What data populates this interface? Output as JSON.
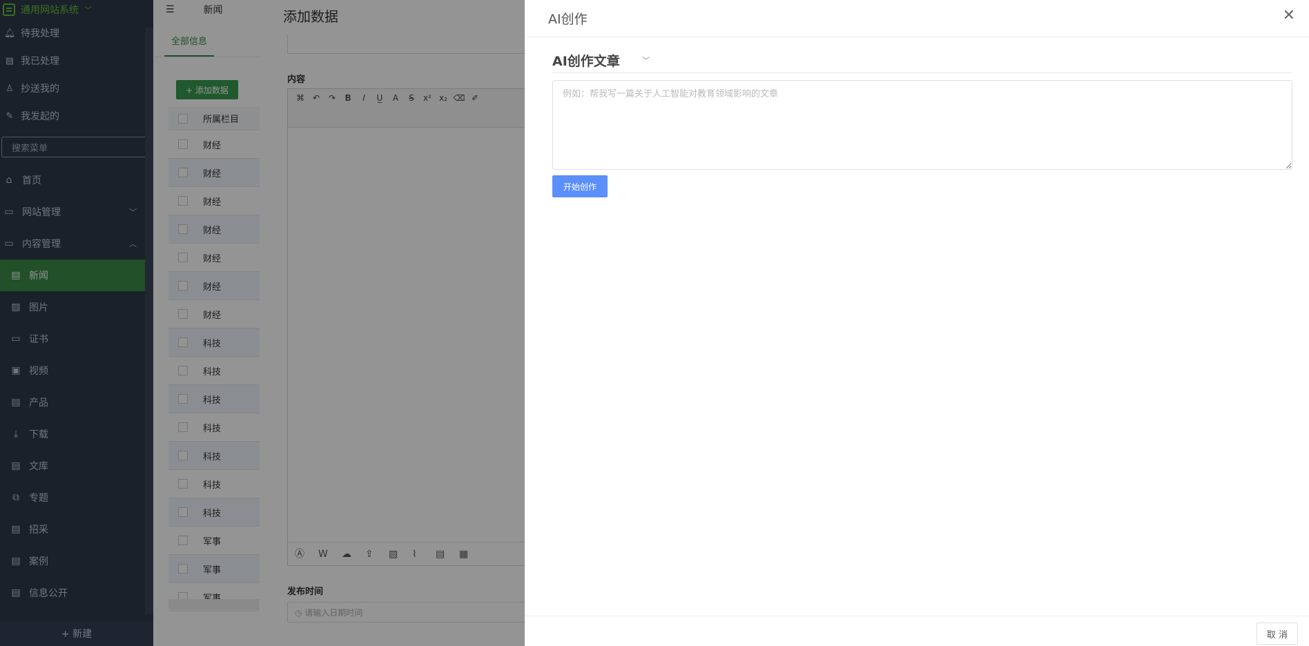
{
  "sidebar": {
    "logo": "通用网站系统",
    "quick": [
      {
        "label": "待我处理",
        "icon": "bell-icon"
      },
      {
        "label": "我已处理",
        "icon": "document-icon"
      },
      {
        "label": "抄送我的",
        "icon": "user-icon"
      },
      {
        "label": "我发起的",
        "icon": "edit-icon"
      }
    ],
    "search_placeholder": "搜索菜单",
    "menu": [
      {
        "label": "首页",
        "icon": "home-icon"
      },
      {
        "label": "网站管理",
        "icon": "folder-icon"
      },
      {
        "label": "内容管理",
        "icon": "folder-icon"
      },
      {
        "label": "新闻",
        "icon": "news-icon"
      },
      {
        "label": "图片",
        "icon": "image-icon"
      },
      {
        "label": "证书",
        "icon": "certificate-icon"
      },
      {
        "label": "视频",
        "icon": "video-icon"
      },
      {
        "label": "产品",
        "icon": "product-icon"
      },
      {
        "label": "下载",
        "icon": "download-icon"
      },
      {
        "label": "文库",
        "icon": "library-icon"
      },
      {
        "label": "专题",
        "icon": "topic-icon"
      },
      {
        "label": "招采",
        "icon": "procurement-icon"
      },
      {
        "label": "案例",
        "icon": "case-icon"
      },
      {
        "label": "信息公开",
        "icon": "info-icon"
      }
    ],
    "new_button": "+ 新建"
  },
  "main": {
    "top_tab": "新闻",
    "sub_tabs": [
      "全部信息"
    ],
    "add_button": "+ 添加数据",
    "grid": {
      "header": "所属栏目",
      "rows": [
        "财经",
        "财经",
        "财经",
        "财经",
        "财经",
        "财经",
        "财经",
        "科技",
        "科技",
        "科技",
        "科技",
        "科技",
        "科技",
        "科技",
        "军事",
        "军事",
        "军事"
      ]
    }
  },
  "add_dialog": {
    "title": "添加数据",
    "content_label": "内容",
    "publish_label": "发布时间",
    "publish_placeholder": "请输入日期时间"
  },
  "drawer": {
    "title": "AI创作",
    "section_title": "AI创作文章",
    "textarea_placeholder": "例如：帮我写一篇关于人工智能对教育领域影响的文章",
    "start_button": "开始创作",
    "cancel_button": "取 消"
  }
}
